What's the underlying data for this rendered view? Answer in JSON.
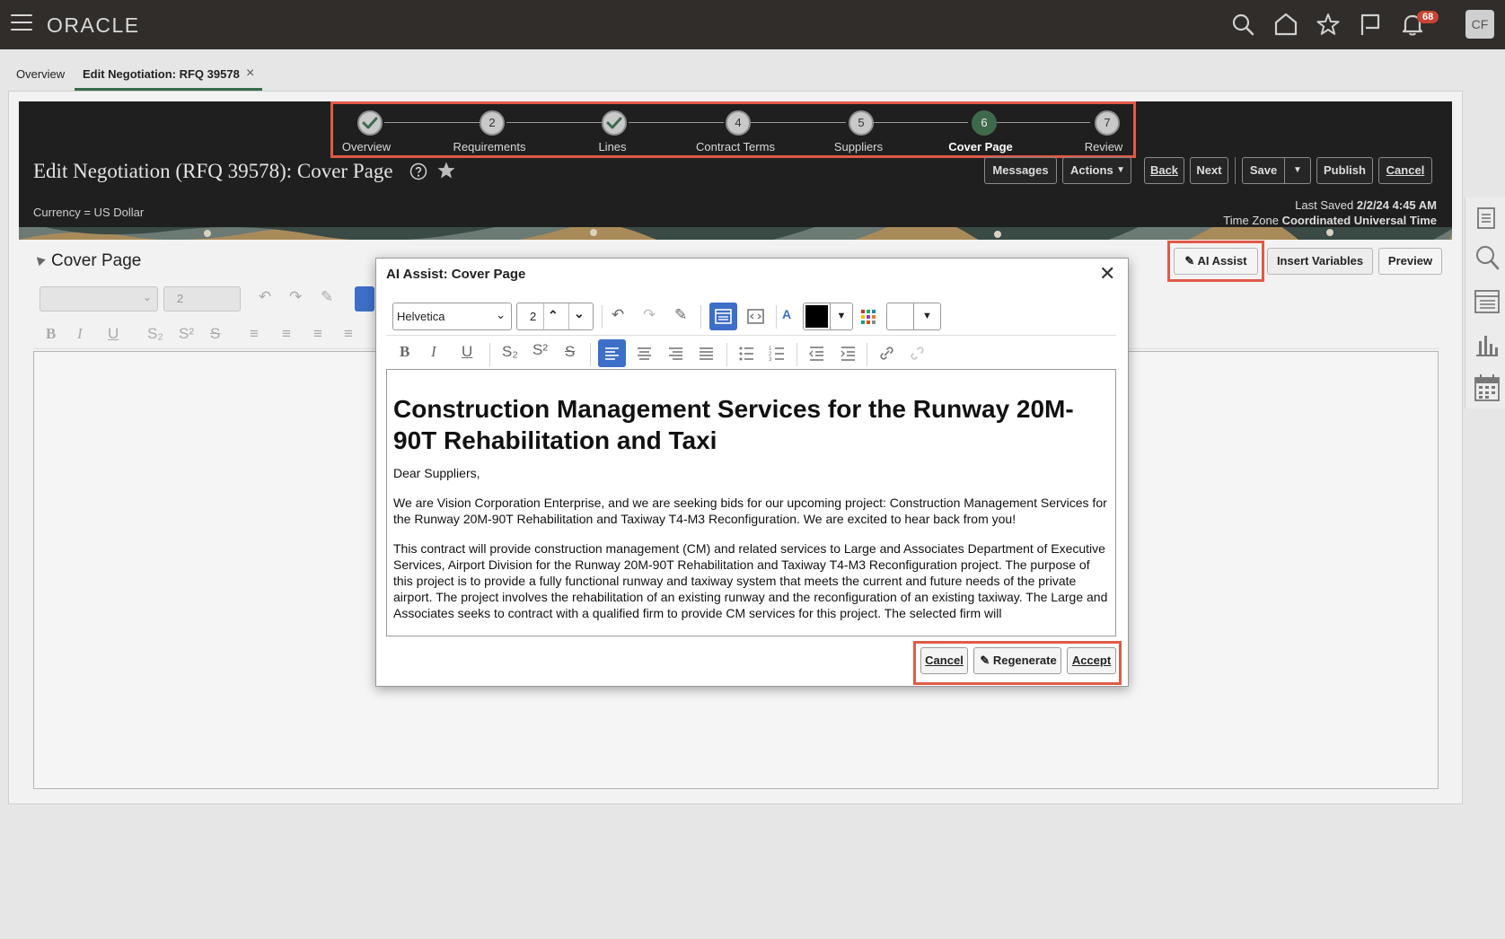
{
  "topbar": {
    "logo": "ORACLE",
    "notifications_count": "68",
    "avatar_initials": "CF"
  },
  "tabs": {
    "overview": "Overview",
    "edit_negotiation": "Edit Negotiation: RFQ 39578",
    "close_glyph": "×"
  },
  "train": {
    "steps": [
      {
        "number": "",
        "label": "Overview",
        "state": "complete"
      },
      {
        "number": "2",
        "label": "Requirements",
        "state": "pending"
      },
      {
        "number": "",
        "label": "Lines",
        "state": "complete"
      },
      {
        "number": "4",
        "label": "Contract Terms",
        "state": "pending"
      },
      {
        "number": "5",
        "label": "Suppliers",
        "state": "pending"
      },
      {
        "number": "6",
        "label": "Cover Page",
        "state": "active"
      },
      {
        "number": "7",
        "label": "Review",
        "state": "pending"
      }
    ]
  },
  "header": {
    "title": "Edit Negotiation (RFQ 39578): Cover Page",
    "currency": "Currency = US Dollar",
    "buttons": {
      "messages": "Messages",
      "actions": "Actions",
      "back": "Back",
      "next": "Next",
      "save": "Save",
      "publish": "Publish",
      "cancel": "Cancel"
    },
    "last_saved_label": "Last Saved",
    "last_saved_value": "2/2/24 4:45 AM",
    "timezone_label": "Time Zone",
    "timezone_value": "Coordinated Universal Time"
  },
  "section": {
    "title": "Cover Page",
    "ai_assist": "AI Assist",
    "insert_variables": "Insert Variables",
    "preview": "Preview",
    "font_size": "2"
  },
  "dialog": {
    "title": "AI Assist: Cover Page",
    "close_glyph": "✕",
    "font": "Helvetica",
    "font_size": "2",
    "text_color": "#000000",
    "background_color": "#ffffff",
    "heading": "Construction Management Services for the Runway 20M-90T Rehabilitation and Taxi",
    "greeting": "Dear Suppliers,",
    "paragraph1": "We are Vision Corporation Enterprise, and we are seeking bids for our upcoming project: Construction Management Services for the Runway 20M-90T Rehabilitation and Taxiway T4-M3 Reconfiguration. We are excited to hear back from you!",
    "paragraph2": "This contract will provide construction management (CM) and related services to Large and Associates Department of Executive Services, Airport Division for the Runway 20M-90T Rehabilitation and Taxiway T4-M3 Reconfiguration project. The purpose of this project is to provide a fully functional runway and taxiway system that meets the current and future needs of the private airport. The project involves the rehabilitation of an existing runway and the reconfiguration of an existing taxiway. The Large and Associates seeks to contract with a qualified firm to provide CM services for this project. The selected firm will",
    "buttons": {
      "cancel": "Cancel",
      "regenerate": "Regenerate",
      "accept": "Accept"
    }
  },
  "colors": {
    "accent_green": "#3e6a4b",
    "highlight_red": "#e05a47",
    "active_blue": "#3d6fc8",
    "badge_red": "#c74634"
  }
}
